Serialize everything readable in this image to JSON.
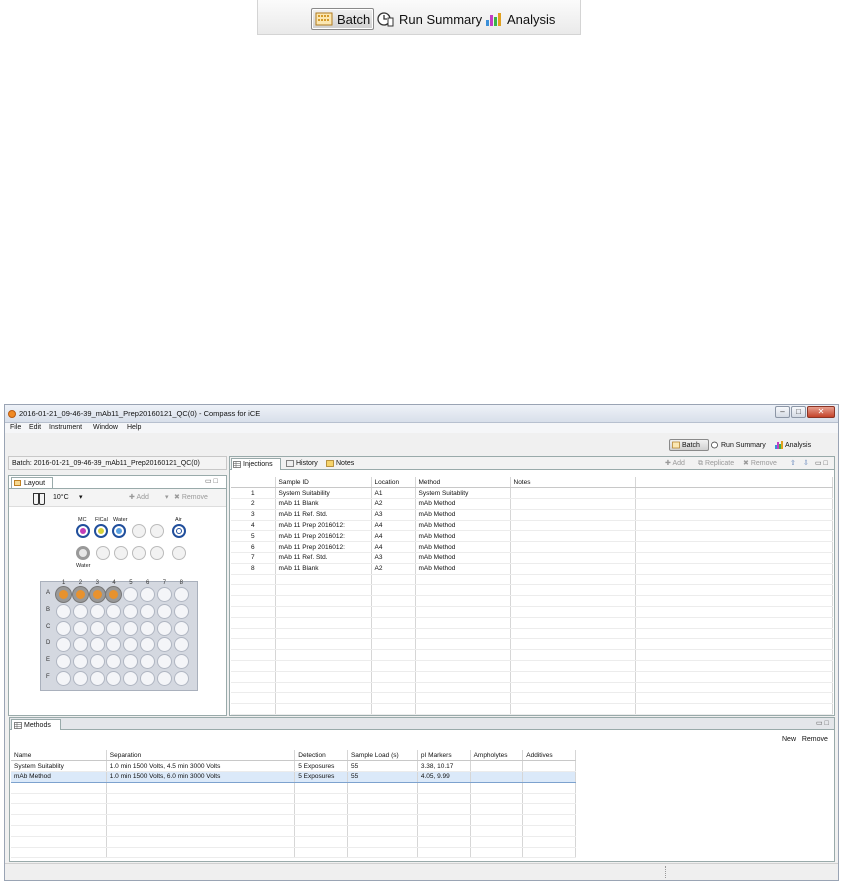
{
  "zoomed_toolbar": {
    "buttons": [
      {
        "label": "Batch",
        "icon": "batch-icon",
        "active": true
      },
      {
        "label": "Run Summary",
        "icon": "run-summary-icon",
        "active": false
      },
      {
        "label": "Analysis",
        "icon": "analysis-icon",
        "active": false
      }
    ]
  },
  "window": {
    "title": "2016-01-21_09-46-39_mAb11_Prep20160121_QC(0) - Compass for iCE",
    "controls": {
      "minimize": "–",
      "maximize": "□",
      "close": "✕"
    }
  },
  "menu": [
    "File",
    "Edit",
    "Instrument",
    "Window",
    "Help"
  ],
  "toolbar": {
    "buttons": [
      {
        "label": "Batch"
      },
      {
        "label": "Run Summary"
      },
      {
        "label": "Analysis"
      }
    ]
  },
  "batch": {
    "label": "Batch:  2016-01-21_09-46-39_mAb11_Prep20160121_QC(0)"
  },
  "layout": {
    "tab": "Layout",
    "temperature": "10°C",
    "chevron": "▾",
    "add": "Add",
    "remove": "Remove",
    "vial_labels": {
      "mc": "MC",
      "fl_cal": "FlCal",
      "water_top": "Water",
      "air": "Air",
      "water_bottom": "Water"
    },
    "columns": [
      "1",
      "2",
      "3",
      "4",
      "5",
      "6",
      "7",
      "8"
    ],
    "rows": [
      "A",
      "B",
      "C",
      "D",
      "E",
      "F"
    ],
    "loaded_wells": [
      "A1",
      "A2",
      "A3",
      "A4"
    ],
    "colors": {
      "loaded_well": "#e8922e",
      "vial_ring": "#214f9c"
    }
  },
  "injections": {
    "tabs": [
      "Injections",
      "History",
      "Notes"
    ],
    "actions": [
      "Add",
      "Replicate",
      "Remove"
    ],
    "columns": [
      "",
      "Sample ID",
      "Location",
      "Method",
      "Notes"
    ],
    "rows": [
      {
        "n": "1",
        "sample": "System Suitability",
        "location": "A1",
        "method": "System Suitablity",
        "notes": ""
      },
      {
        "n": "2",
        "sample": "mAb 11 Blank",
        "location": "A2",
        "method": "mAb Method",
        "notes": ""
      },
      {
        "n": "3",
        "sample": "mAb 11 Ref. Std.",
        "location": "A3",
        "method": "mAb Method",
        "notes": ""
      },
      {
        "n": "4",
        "sample": "mAb 11 Prep 2016012:",
        "location": "A4",
        "method": "mAb Method",
        "notes": ""
      },
      {
        "n": "5",
        "sample": "mAb 11 Prep 2016012:",
        "location": "A4",
        "method": "mAb Method",
        "notes": ""
      },
      {
        "n": "6",
        "sample": "mAb 11 Prep 2016012:",
        "location": "A4",
        "method": "mAb Method",
        "notes": ""
      },
      {
        "n": "7",
        "sample": "mAb 11 Ref. Std.",
        "location": "A3",
        "method": "mAb Method",
        "notes": ""
      },
      {
        "n": "8",
        "sample": "mAb 11 Blank",
        "location": "A2",
        "method": "mAb Method",
        "notes": ""
      }
    ],
    "empty_rows": 13
  },
  "methods": {
    "tab": "Methods",
    "actions": [
      "New",
      "Remove"
    ],
    "columns": [
      "Name",
      "Separation",
      "Detection",
      "Sample Load (s)",
      "pI Markers",
      "Ampholytes",
      "Additives"
    ],
    "rows": [
      {
        "name": "System Suitablity",
        "separation": "1.0 min 1500 Volts, 4.5 min 3000 Volts",
        "detection": "5 Exposures",
        "load": "55",
        "pi": "3.38, 10.17",
        "ampholytes": "",
        "additives": "",
        "selected": false
      },
      {
        "name": "mAb Method",
        "separation": "1.0 min 1500 Volts, 6.0 min 3000 Volts",
        "detection": "5 Exposures",
        "load": "55",
        "pi": "4.05, 9.99",
        "ampholytes": "",
        "additives": "",
        "selected": true
      }
    ],
    "empty_rows": 7
  }
}
